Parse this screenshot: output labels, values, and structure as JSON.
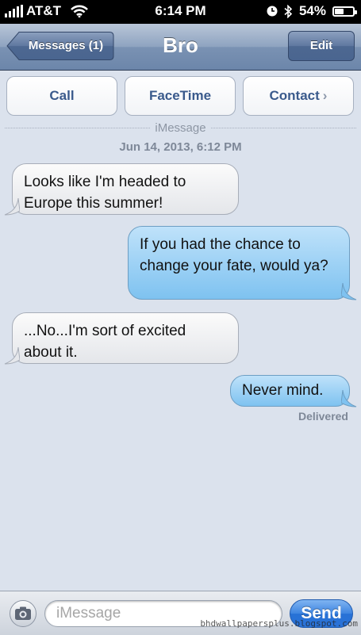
{
  "status_bar": {
    "carrier": "AT&T",
    "time": "6:14 PM",
    "battery_percent": "54%",
    "battery_level": 0.54,
    "icons": [
      "signal-icon",
      "wifi-icon",
      "clock-icon",
      "bluetooth-icon",
      "battery-icon"
    ]
  },
  "nav": {
    "back_label": "Messages (1)",
    "title": "Bro",
    "edit_label": "Edit"
  },
  "actions": {
    "call_label": "Call",
    "facetime_label": "FaceTime",
    "contact_label": "Contact",
    "contact_chevron": "›"
  },
  "conversation": {
    "service_label": "iMessage",
    "timestamp": "Jun 14, 2013, 6:12 PM",
    "messages": [
      {
        "direction": "received",
        "text": "Looks like I'm headed to Europe this summer!"
      },
      {
        "direction": "sent",
        "text": "If you had the chance to change your fate, would ya?"
      },
      {
        "direction": "received",
        "text": "...No...I'm sort of excited about it."
      },
      {
        "direction": "sent",
        "text": "Never mind."
      }
    ],
    "delivered_label": "Delivered"
  },
  "composer": {
    "placeholder": "iMessage",
    "value": "",
    "send_label": "Send"
  },
  "watermark": "bhdwallpapersplus.blogspot.com",
  "colors": {
    "background": "#dbe2ed",
    "sent_bubble": "#7ec2f0",
    "received_bubble": "#e4e6ea",
    "nav_bar": "#7a92b3",
    "send_button": "#2a73d8"
  }
}
